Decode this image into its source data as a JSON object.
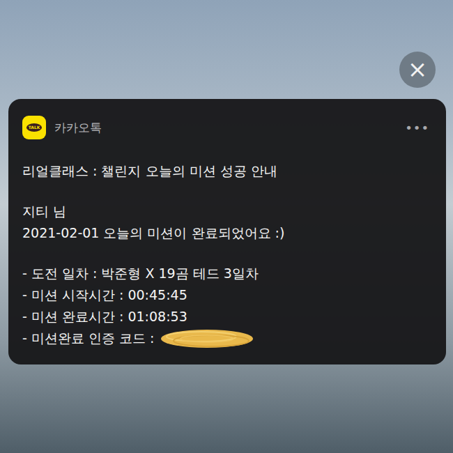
{
  "close": {
    "label": "×"
  },
  "app": {
    "name": "카카오톡",
    "icon_text": "TALK",
    "menu": "•••"
  },
  "notification": {
    "title": "리얼클래스 : 챌린지 오늘의 미션 성공 안내",
    "greeting": "지티 님",
    "message": "2021-02-01 오늘의 미션이 완료되었어요 :)",
    "details": [
      {
        "text": "- 도전 일차 : 박준형 X 19곰 테드 3일차",
        "redacted": false
      },
      {
        "text": "- 미션 시작시간 : 00:45:45",
        "redacted": false
      },
      {
        "text": "- 미션 완료시간 : 01:08:53",
        "redacted": false
      },
      {
        "text": "- 미션완료 인증 코드 :",
        "redacted": true
      }
    ]
  }
}
